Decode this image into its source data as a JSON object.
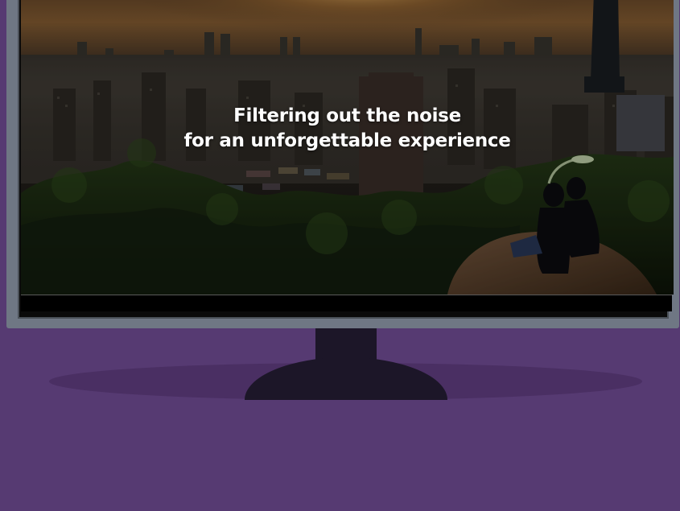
{
  "hero": {
    "line1": "Filtering out the noise",
    "line2": "for an unforgettable experience"
  },
  "colors": {
    "background": "#563a72",
    "floor_shadow": "#4a2f63",
    "monitor_frame": "#6f7784",
    "stand": "#1c1628",
    "text": "#ffffff"
  },
  "image": {
    "description_icon": "city-skyline-photo"
  }
}
